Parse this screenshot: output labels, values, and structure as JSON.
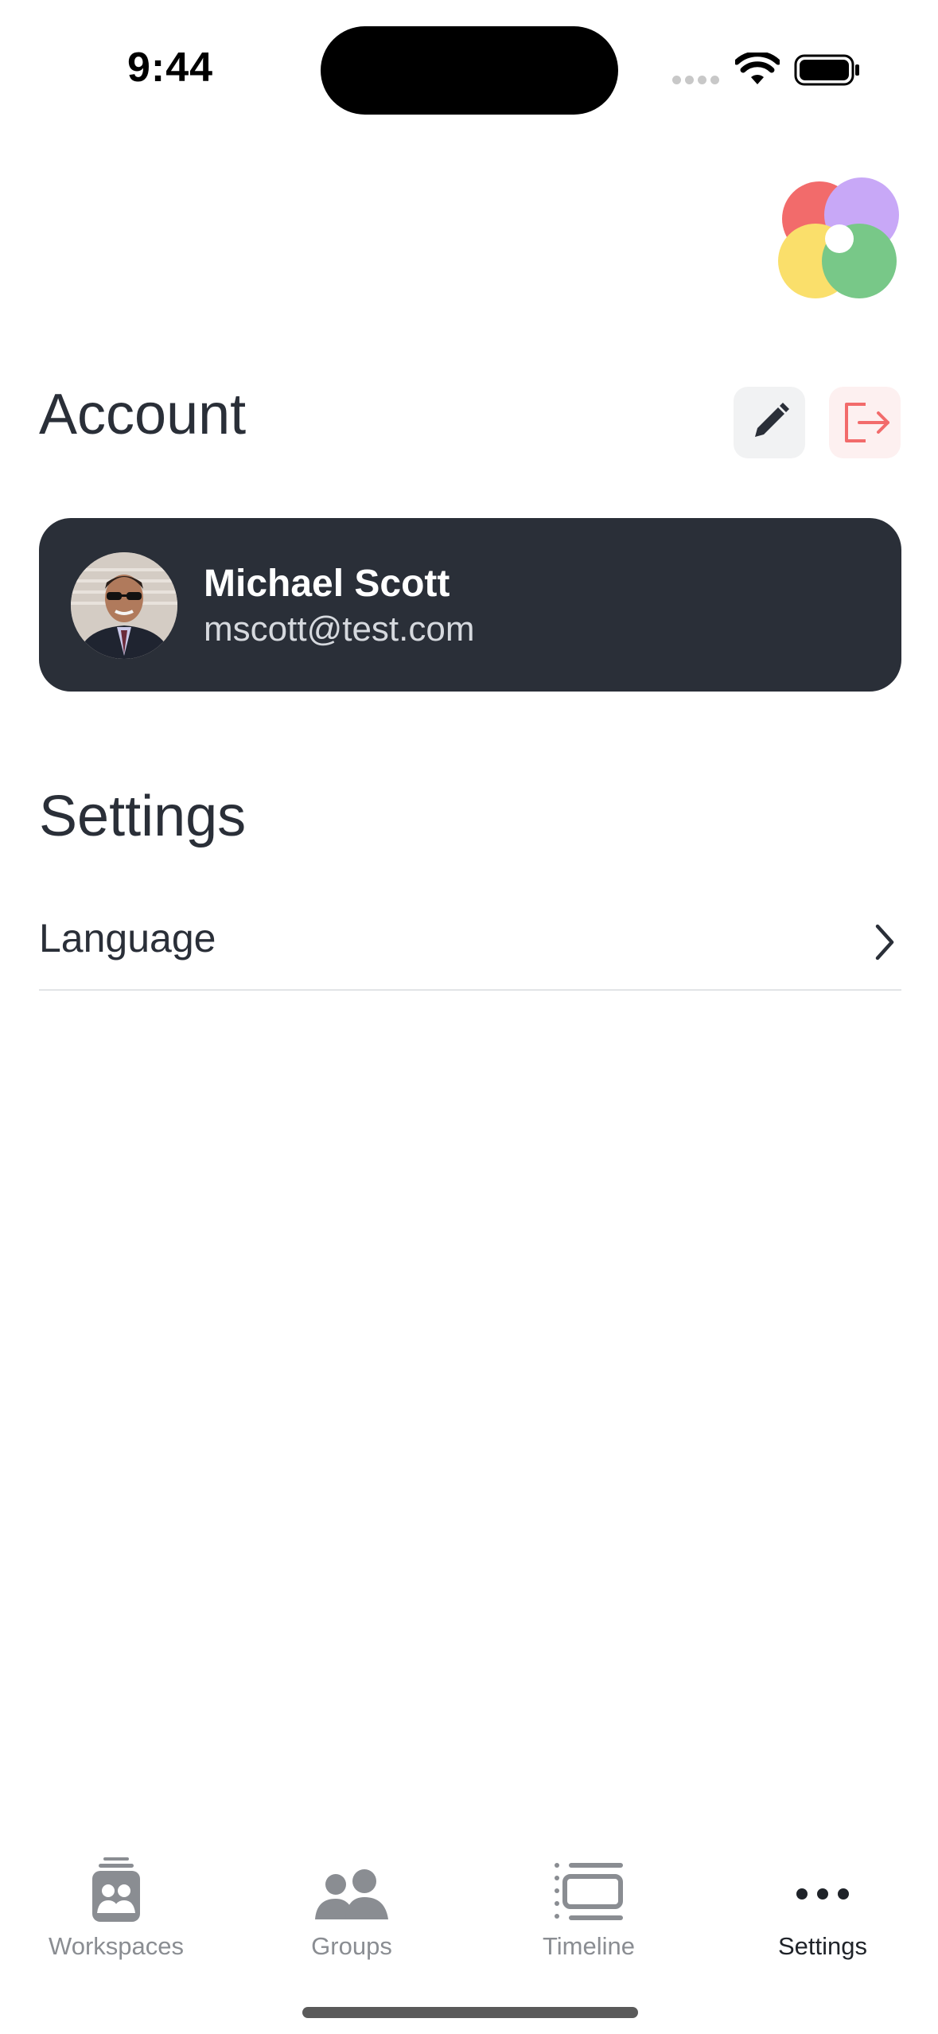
{
  "status_bar": {
    "time": "9:44",
    "icons": [
      "cellular-signal-icon",
      "wifi-icon",
      "battery-icon"
    ]
  },
  "brand": {
    "logo": "colorful-petal-logo"
  },
  "account": {
    "title": "Account",
    "edit_icon": "pencil-icon",
    "logout_icon": "logout-icon",
    "user": {
      "name": "Michael Scott",
      "email": "mscott@test.com",
      "avatar": "user-avatar-photo"
    }
  },
  "settings": {
    "title": "Settings",
    "items": [
      {
        "label": "Language",
        "icon": "chevron-right-icon"
      }
    ]
  },
  "tab_bar": {
    "tabs": [
      {
        "label": "Workspaces",
        "icon": "workspaces-icon"
      },
      {
        "label": "Groups",
        "icon": "groups-icon"
      },
      {
        "label": "Timeline",
        "icon": "timeline-icon"
      },
      {
        "label": "Settings",
        "icon": "more-dots-icon",
        "active": true
      }
    ]
  },
  "colors": {
    "text_dark": "#2a2f38",
    "card_bg": "#2a2f38",
    "logout_accent": "#f26b6b",
    "tab_inactive": "#8a8d92",
    "divider": "#e2e4e7"
  }
}
